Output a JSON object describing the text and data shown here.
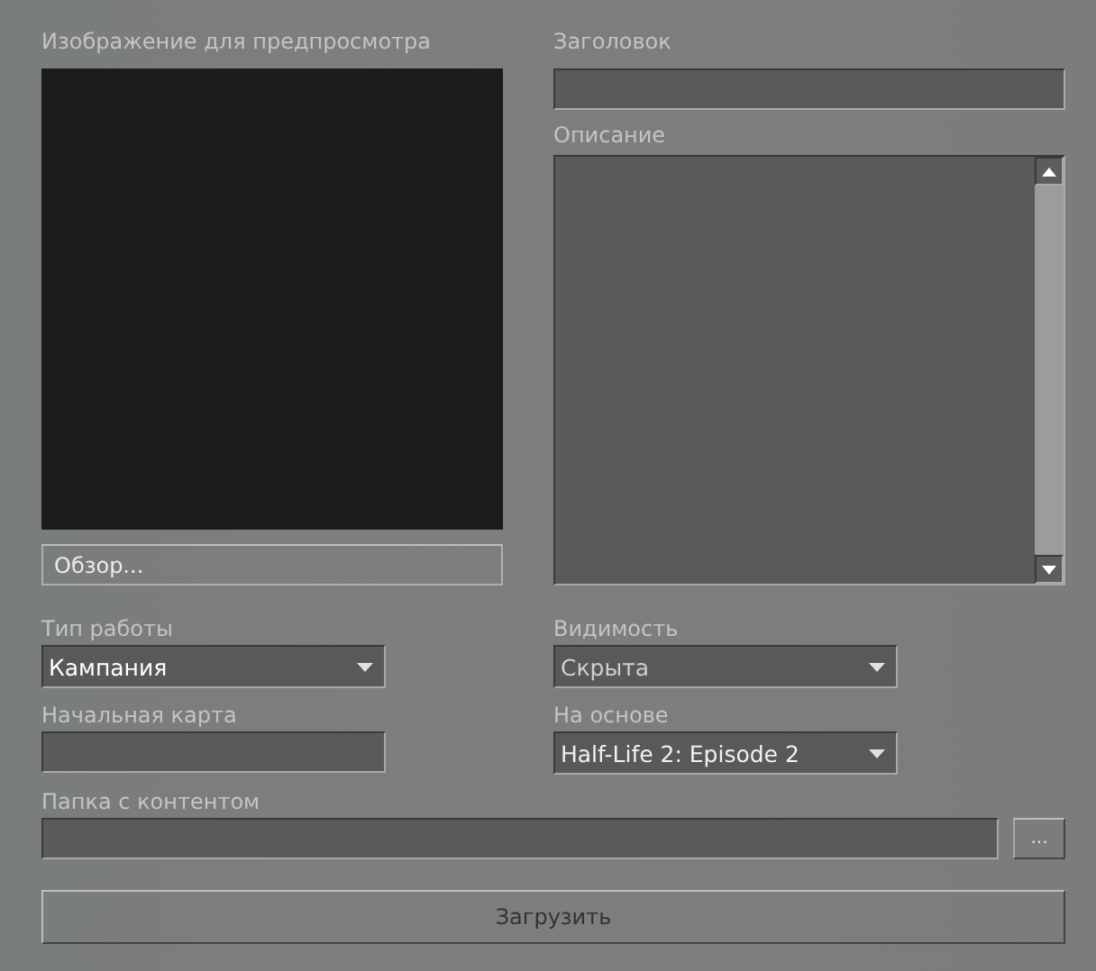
{
  "preview": {
    "label": "Изображение для предпросмотра",
    "browse_button": "Обзор..."
  },
  "title": {
    "label": "Заголовок"
  },
  "description": {
    "label": "Описание"
  },
  "work_type": {
    "label": "Тип работы",
    "value": "Кампания"
  },
  "visibility": {
    "label": "Видимость",
    "value": "Скрыта"
  },
  "start_map": {
    "label": "Начальная карта"
  },
  "based_on": {
    "label": "На основе",
    "value": "Half-Life 2: Episode 2"
  },
  "content_folder": {
    "label": "Папка с контентом",
    "button": "..."
  },
  "upload_button": "Загрузить"
}
